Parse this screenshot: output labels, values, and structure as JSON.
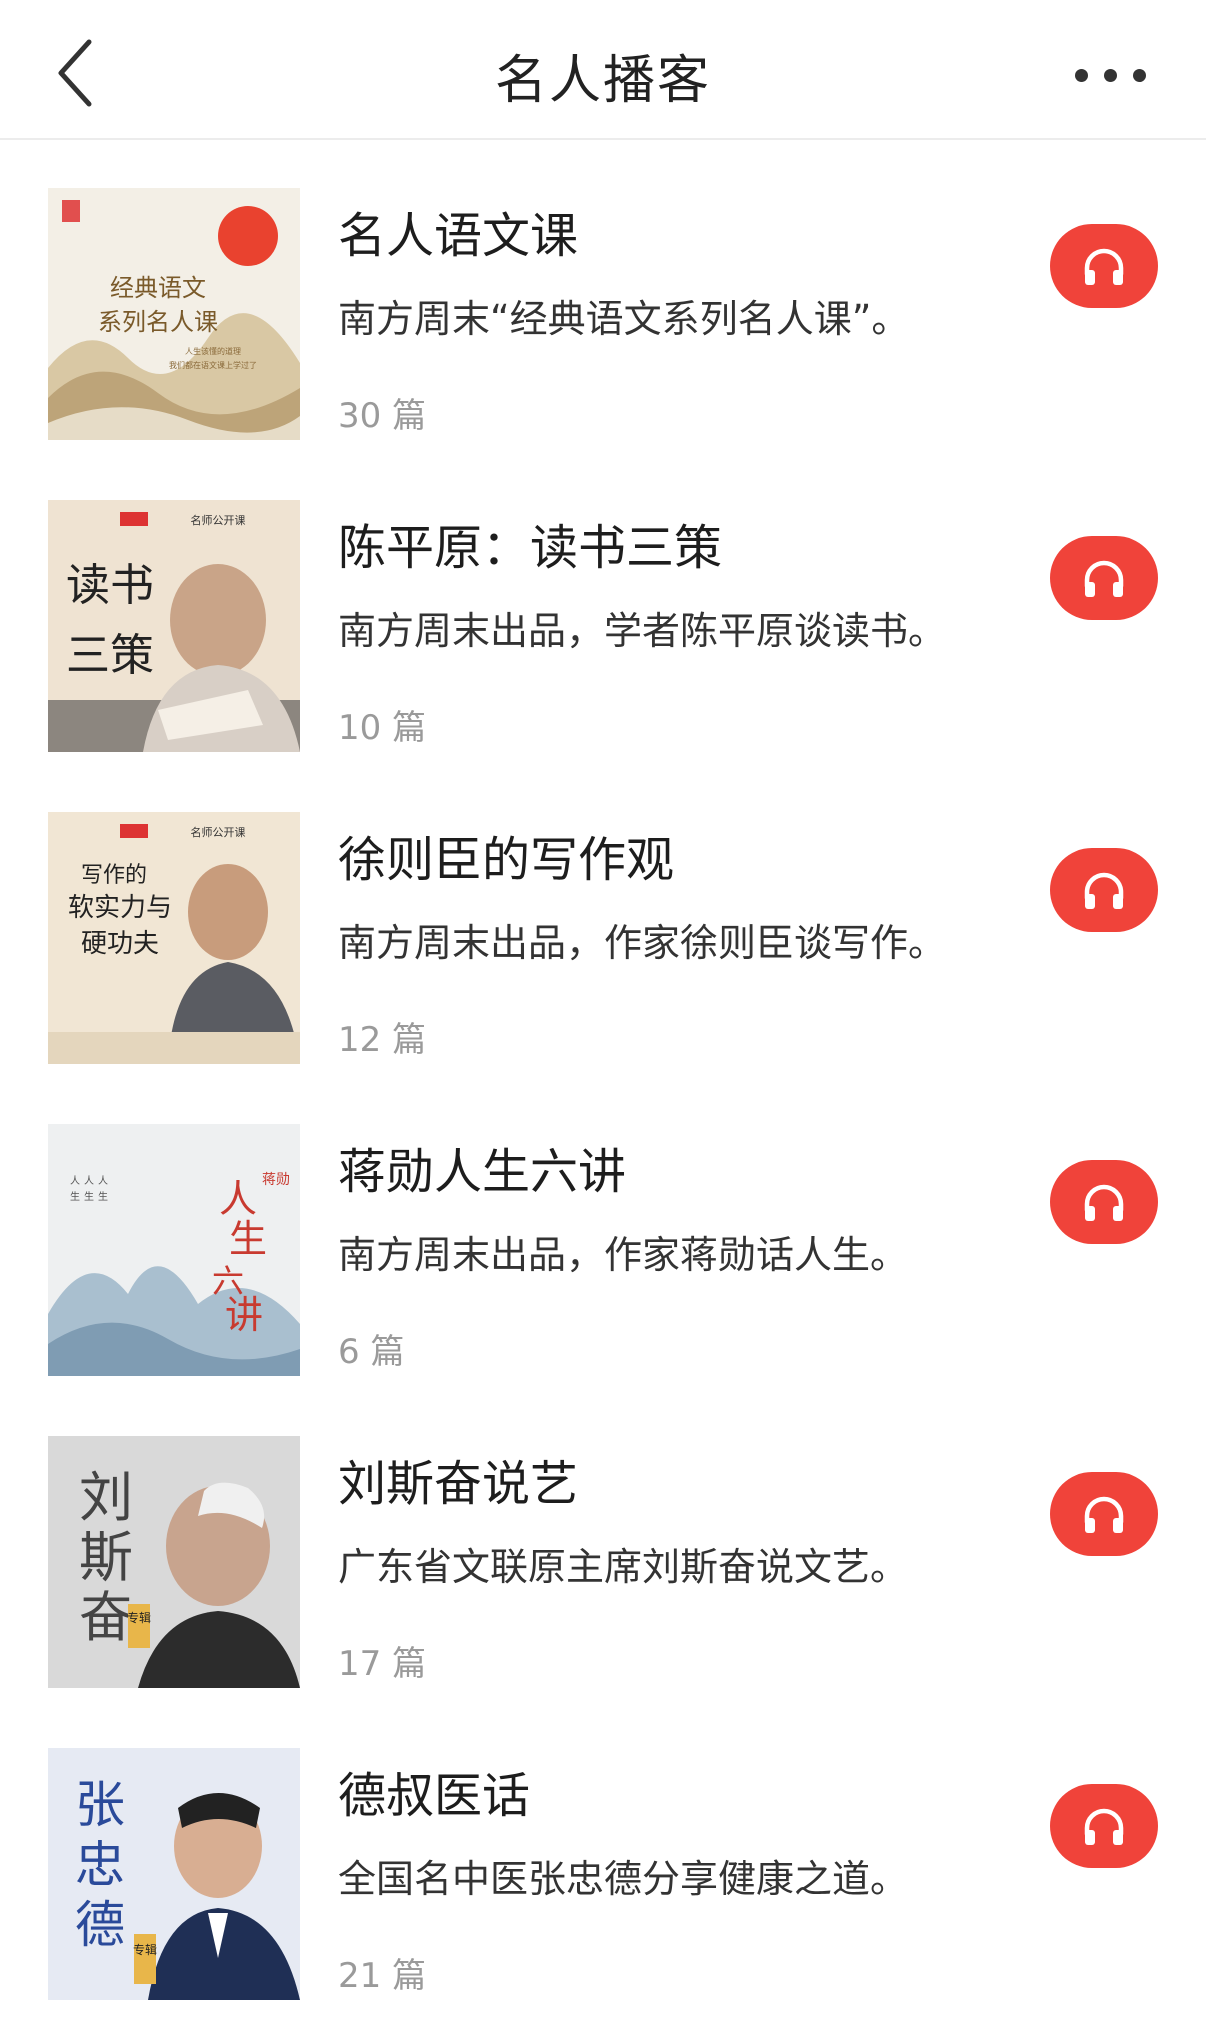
{
  "header": {
    "title": "名人播客",
    "back_icon": "chevron-left-icon",
    "more_icon": "more-horizontal-icon"
  },
  "podcasts": [
    {
      "title": "名人语文课",
      "description": "南方周末“经典语文系列名人课”。",
      "count": "30 篇",
      "cover_text": [
        "经典语文",
        "系列名人课"
      ],
      "cover_subtext": [
        "人生该懂的道理",
        "我们都在语文课上学过了"
      ]
    },
    {
      "title": "陈平原：读书三策",
      "description": "南方周末出品，学者陈平原谈读书。",
      "count": "10 篇",
      "cover_text": [
        "读书",
        "三策"
      ],
      "cover_tag": "名师公开课"
    },
    {
      "title": "徐则臣的写作观",
      "description": "南方周末出品，作家徐则臣谈写作。",
      "count": "12 篇",
      "cover_text": [
        "写作的",
        "软实力与",
        "硬功夫"
      ],
      "cover_tag": "名师公开课"
    },
    {
      "title": "蒋勋人生六讲",
      "description": "南方周末出品，作家蒋勋话人生。",
      "count": "6 篇",
      "cover_text": [
        "人",
        "生",
        "六",
        "讲"
      ],
      "cover_tag": "蒋勋"
    },
    {
      "title": "刘斯奋说艺",
      "description": "广东省文联原主席刘斯奋说文艺。",
      "count": "17 篇",
      "cover_text": [
        "刘",
        "斯",
        "奋"
      ],
      "cover_tag": "专辑"
    },
    {
      "title": "德叔医话",
      "description": "全国名中医张忠德分享健康之道。",
      "count": "21 篇",
      "cover_text": [
        "张",
        "忠",
        "德"
      ],
      "cover_tag": "专辑"
    }
  ],
  "listen_icon": "headphones-icon",
  "colors": {
    "accent": "#f0433a",
    "muted": "#9a9a9a"
  }
}
